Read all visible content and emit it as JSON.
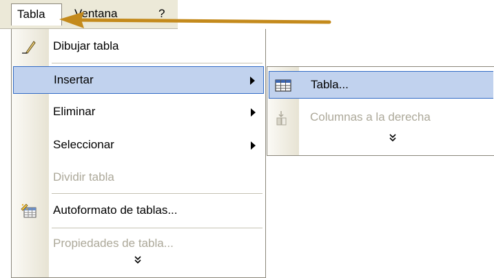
{
  "menubar": {
    "items": [
      {
        "label": "Tabla"
      },
      {
        "label": "Ventana"
      },
      {
        "label": "?"
      }
    ]
  },
  "menu": {
    "items": [
      {
        "label": "Dibujar tabla",
        "icon": "pencil-icon",
        "enabled": true
      },
      {
        "label": "Insertar",
        "enabled": true,
        "submenu": true,
        "highlighted": true
      },
      {
        "label": "Eliminar",
        "enabled": true,
        "submenu": true
      },
      {
        "label": "Seleccionar",
        "enabled": true,
        "submenu": true
      },
      {
        "label": "Dividir tabla",
        "enabled": false
      },
      {
        "label": "Autoformato de tablas...",
        "icon": "table-autoformat-icon",
        "enabled": true
      },
      {
        "label": "Propiedades de tabla...",
        "enabled": false
      }
    ],
    "expand_glyph": "»"
  },
  "submenu": {
    "items": [
      {
        "label": "Tabla...",
        "icon": "insert-table-icon",
        "enabled": true,
        "highlighted": true
      },
      {
        "label": "Columnas a la derecha",
        "icon": "insert-columns-right-icon",
        "enabled": false
      }
    ],
    "expand_glyph": "»"
  },
  "colors": {
    "highlight_bg": "#c1d2ee",
    "highlight_border": "#316ac5",
    "disabled_text": "#aca899",
    "arrow": "#c48a1c"
  }
}
